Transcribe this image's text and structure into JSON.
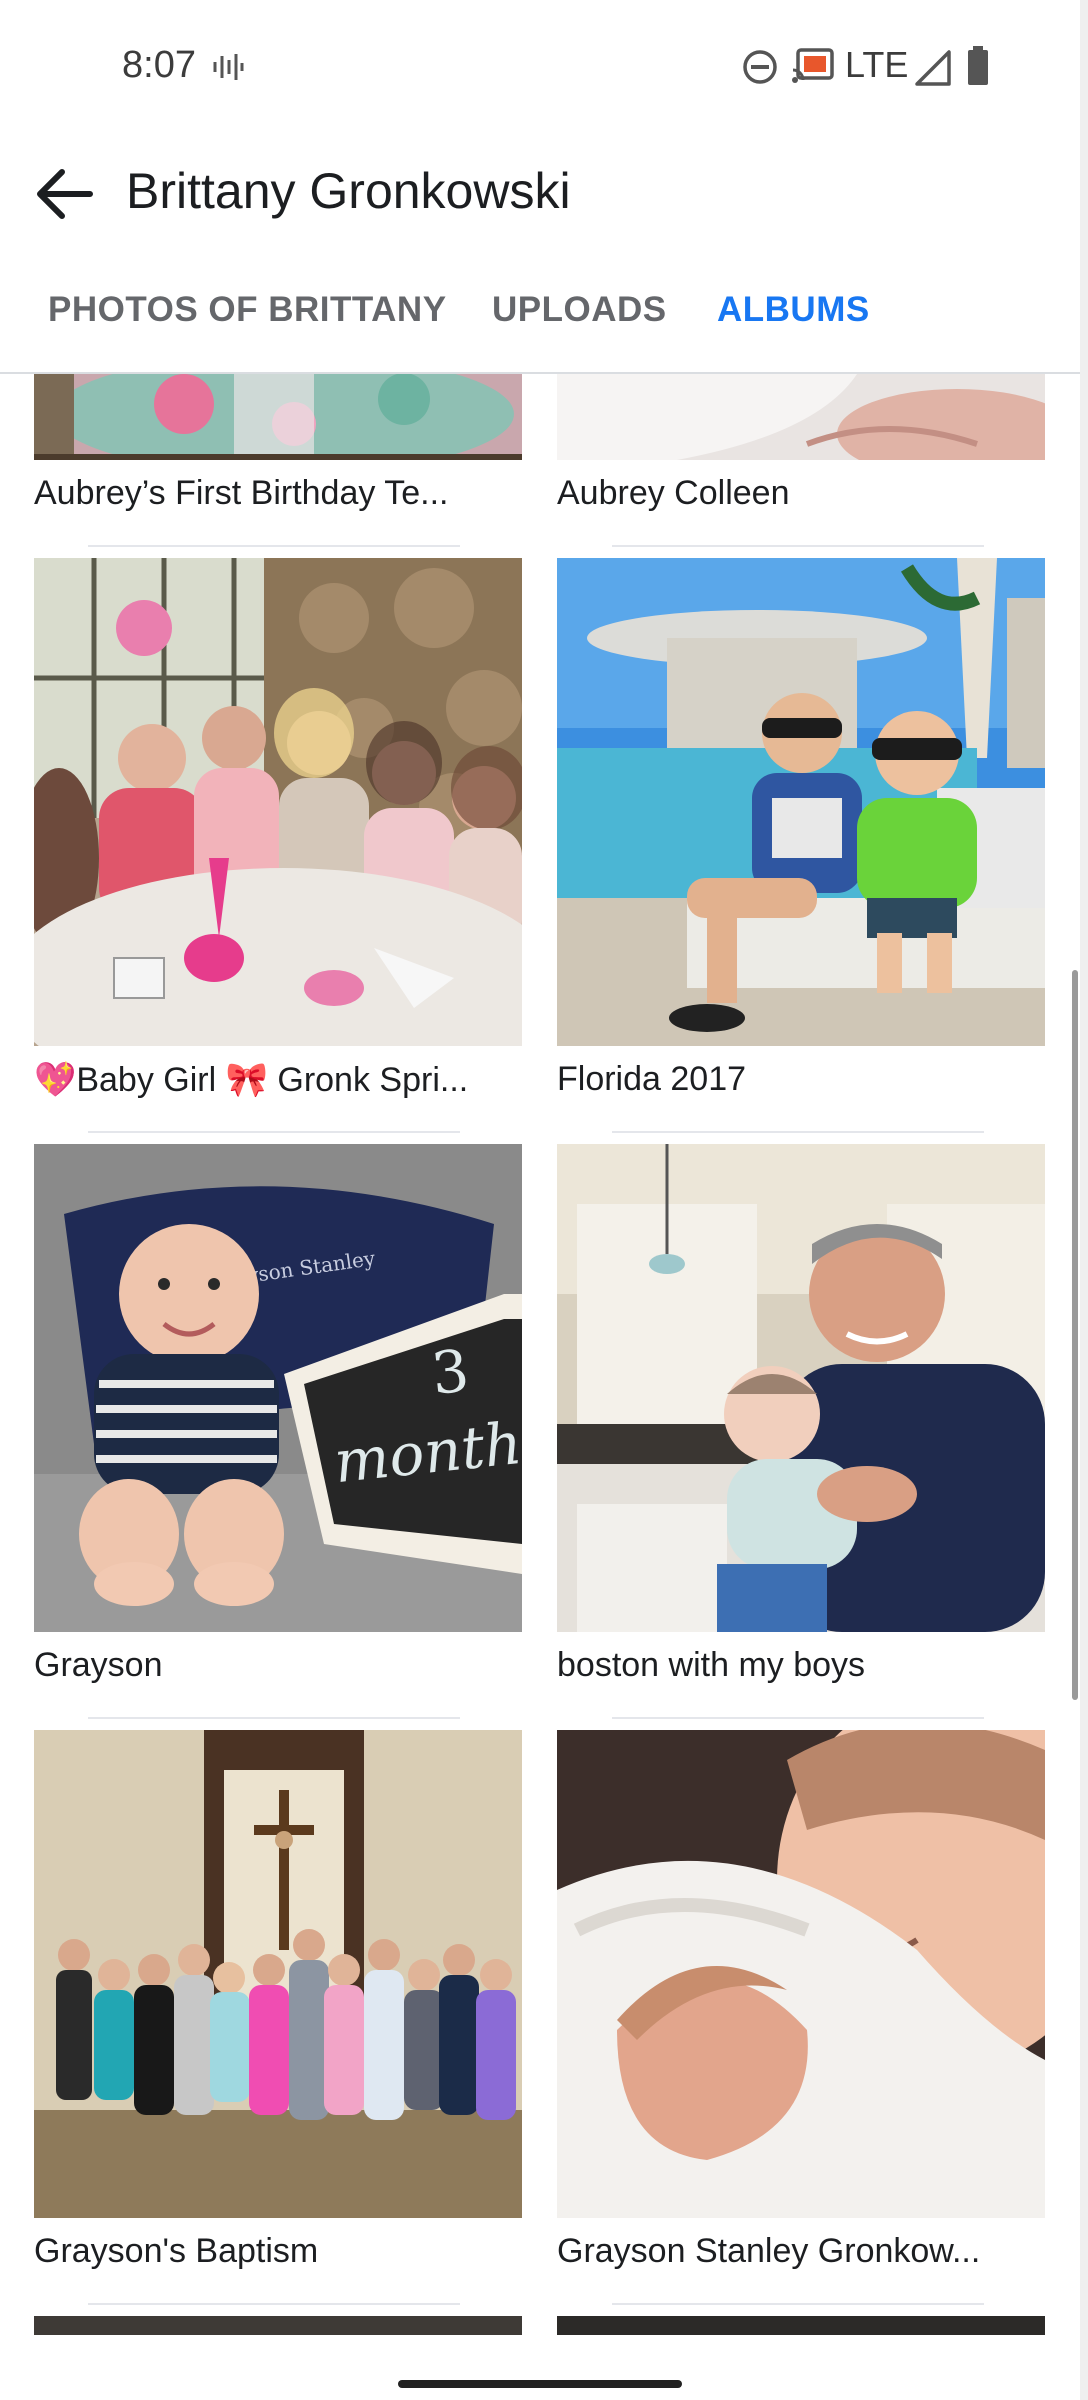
{
  "status_bar": {
    "time": "8:07",
    "network": "LTE",
    "icons": [
      "voicemail-icon",
      "do-not-disturb-icon",
      "cast-icon",
      "signal-icon",
      "battery-icon"
    ]
  },
  "header": {
    "title": "Brittany Gronkowski",
    "back_icon": "arrow-back-icon"
  },
  "tabs": [
    {
      "label": "PHOTOS OF BRITTANY",
      "active": false
    },
    {
      "label": "UPLOADS",
      "active": false
    },
    {
      "label": "ALBUMS",
      "active": true
    }
  ],
  "albums": [
    {
      "caption": "Aubrey’s First Birthday Te..."
    },
    {
      "caption": "Aubrey Colleen"
    },
    {
      "caption": "💖Baby Girl 🎀 Gronk Spri..."
    },
    {
      "caption": "Florida 2017"
    },
    {
      "caption": "Grayson"
    },
    {
      "caption": "boston with my boys"
    },
    {
      "caption": "Grayson's Baptism"
    },
    {
      "caption": "Grayson Stanley Gronkow..."
    }
  ],
  "photo_text": {
    "blanket_text": "Grayson Stanley",
    "sign_number": "3",
    "sign_word": "months"
  },
  "colors": {
    "accent": "#1877f2",
    "tab_inactive": "#65676b",
    "text": "#1c1e21"
  }
}
